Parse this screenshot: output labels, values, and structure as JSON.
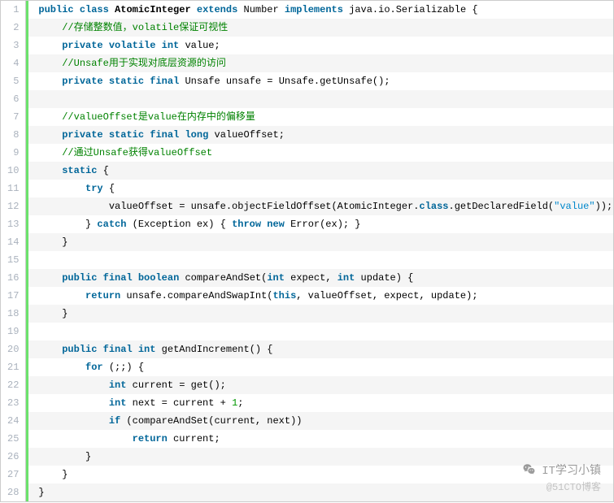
{
  "watermark": {
    "title": "IT学习小镇",
    "subtitle": "@51CTO博客"
  },
  "code": [
    {
      "n": 1,
      "alt": false,
      "indent": 0,
      "tokens": [
        {
          "t": "kw",
          "v": "public"
        },
        {
          "t": "plain",
          "v": " "
        },
        {
          "t": "kw",
          "v": "class"
        },
        {
          "t": "plain",
          "v": " "
        },
        {
          "t": "id",
          "v": "AtomicInteger"
        },
        {
          "t": "plain",
          "v": " "
        },
        {
          "t": "kw",
          "v": "extends"
        },
        {
          "t": "plain",
          "v": " Number "
        },
        {
          "t": "kw",
          "v": "implements"
        },
        {
          "t": "plain",
          "v": " java.io.Serializable {"
        }
      ]
    },
    {
      "n": 2,
      "alt": true,
      "indent": 1,
      "tokens": [
        {
          "t": "cmt",
          "v": "//存储整数值，volatile保证可视性"
        }
      ]
    },
    {
      "n": 3,
      "alt": false,
      "indent": 1,
      "tokens": [
        {
          "t": "kw",
          "v": "private"
        },
        {
          "t": "plain",
          "v": " "
        },
        {
          "t": "kw",
          "v": "volatile"
        },
        {
          "t": "plain",
          "v": " "
        },
        {
          "t": "kw",
          "v": "int"
        },
        {
          "t": "plain",
          "v": " value;"
        }
      ]
    },
    {
      "n": 4,
      "alt": true,
      "indent": 1,
      "tokens": [
        {
          "t": "cmt",
          "v": "//Unsafe用于实现对底层资源的访问"
        }
      ]
    },
    {
      "n": 5,
      "alt": false,
      "indent": 1,
      "tokens": [
        {
          "t": "kw",
          "v": "private"
        },
        {
          "t": "plain",
          "v": " "
        },
        {
          "t": "kw",
          "v": "static"
        },
        {
          "t": "plain",
          "v": " "
        },
        {
          "t": "kw",
          "v": "final"
        },
        {
          "t": "plain",
          "v": " Unsafe unsafe = Unsafe.getUnsafe();"
        }
      ]
    },
    {
      "n": 6,
      "alt": true,
      "indent": 0,
      "tokens": [
        {
          "t": "plain",
          "v": ""
        }
      ]
    },
    {
      "n": 7,
      "alt": false,
      "indent": 1,
      "tokens": [
        {
          "t": "cmt",
          "v": "//valueOffset是value在内存中的偏移量"
        }
      ]
    },
    {
      "n": 8,
      "alt": true,
      "indent": 1,
      "tokens": [
        {
          "t": "kw",
          "v": "private"
        },
        {
          "t": "plain",
          "v": " "
        },
        {
          "t": "kw",
          "v": "static"
        },
        {
          "t": "plain",
          "v": " "
        },
        {
          "t": "kw",
          "v": "final"
        },
        {
          "t": "plain",
          "v": " "
        },
        {
          "t": "kw",
          "v": "long"
        },
        {
          "t": "plain",
          "v": " valueOffset;"
        }
      ]
    },
    {
      "n": 9,
      "alt": false,
      "indent": 1,
      "tokens": [
        {
          "t": "cmt",
          "v": "//通过Unsafe获得valueOffset"
        }
      ]
    },
    {
      "n": 10,
      "alt": true,
      "indent": 1,
      "tokens": [
        {
          "t": "kw",
          "v": "static"
        },
        {
          "t": "plain",
          "v": " {"
        }
      ]
    },
    {
      "n": 11,
      "alt": false,
      "indent": 2,
      "tokens": [
        {
          "t": "kw",
          "v": "try"
        },
        {
          "t": "plain",
          "v": " {"
        }
      ]
    },
    {
      "n": 12,
      "alt": true,
      "indent": 3,
      "tokens": [
        {
          "t": "plain",
          "v": "valueOffset = unsafe.objectFieldOffset(AtomicInteger."
        },
        {
          "t": "kw",
          "v": "class"
        },
        {
          "t": "plain",
          "v": ".getDeclaredField("
        },
        {
          "t": "str",
          "v": "\"value\""
        },
        {
          "t": "plain",
          "v": "));"
        }
      ]
    },
    {
      "n": 13,
      "alt": false,
      "indent": 2,
      "tokens": [
        {
          "t": "plain",
          "v": "} "
        },
        {
          "t": "kw",
          "v": "catch"
        },
        {
          "t": "plain",
          "v": " (Exception ex) { "
        },
        {
          "t": "kw",
          "v": "throw"
        },
        {
          "t": "plain",
          "v": " "
        },
        {
          "t": "kw",
          "v": "new"
        },
        {
          "t": "plain",
          "v": " Error(ex); }"
        }
      ]
    },
    {
      "n": 14,
      "alt": true,
      "indent": 1,
      "tokens": [
        {
          "t": "plain",
          "v": "}"
        }
      ]
    },
    {
      "n": 15,
      "alt": false,
      "indent": 0,
      "tokens": [
        {
          "t": "plain",
          "v": ""
        }
      ]
    },
    {
      "n": 16,
      "alt": true,
      "indent": 1,
      "tokens": [
        {
          "t": "kw",
          "v": "public"
        },
        {
          "t": "plain",
          "v": " "
        },
        {
          "t": "kw",
          "v": "final"
        },
        {
          "t": "plain",
          "v": " "
        },
        {
          "t": "kw",
          "v": "boolean"
        },
        {
          "t": "plain",
          "v": " compareAndSet("
        },
        {
          "t": "kw",
          "v": "int"
        },
        {
          "t": "plain",
          "v": " expect, "
        },
        {
          "t": "kw",
          "v": "int"
        },
        {
          "t": "plain",
          "v": " update) {"
        }
      ]
    },
    {
      "n": 17,
      "alt": false,
      "indent": 2,
      "tokens": [
        {
          "t": "kw",
          "v": "return"
        },
        {
          "t": "plain",
          "v": " unsafe.compareAndSwapInt("
        },
        {
          "t": "kw",
          "v": "this"
        },
        {
          "t": "plain",
          "v": ", valueOffset, expect, update);"
        }
      ]
    },
    {
      "n": 18,
      "alt": true,
      "indent": 1,
      "tokens": [
        {
          "t": "plain",
          "v": "}"
        }
      ]
    },
    {
      "n": 19,
      "alt": false,
      "indent": 0,
      "tokens": [
        {
          "t": "plain",
          "v": ""
        }
      ]
    },
    {
      "n": 20,
      "alt": true,
      "indent": 1,
      "tokens": [
        {
          "t": "kw",
          "v": "public"
        },
        {
          "t": "plain",
          "v": " "
        },
        {
          "t": "kw",
          "v": "final"
        },
        {
          "t": "plain",
          "v": " "
        },
        {
          "t": "kw",
          "v": "int"
        },
        {
          "t": "plain",
          "v": " getAndIncrement() {"
        }
      ]
    },
    {
      "n": 21,
      "alt": false,
      "indent": 2,
      "tokens": [
        {
          "t": "kw",
          "v": "for"
        },
        {
          "t": "plain",
          "v": " (;;) {"
        }
      ]
    },
    {
      "n": 22,
      "alt": true,
      "indent": 3,
      "tokens": [
        {
          "t": "kw",
          "v": "int"
        },
        {
          "t": "plain",
          "v": " current = get();"
        }
      ]
    },
    {
      "n": 23,
      "alt": false,
      "indent": 3,
      "tokens": [
        {
          "t": "kw",
          "v": "int"
        },
        {
          "t": "plain",
          "v": " next = current + "
        },
        {
          "t": "num",
          "v": "1"
        },
        {
          "t": "plain",
          "v": ";"
        }
      ]
    },
    {
      "n": 24,
      "alt": true,
      "indent": 3,
      "tokens": [
        {
          "t": "kw",
          "v": "if"
        },
        {
          "t": "plain",
          "v": " (compareAndSet(current, next))"
        }
      ]
    },
    {
      "n": 25,
      "alt": false,
      "indent": 4,
      "tokens": [
        {
          "t": "kw",
          "v": "return"
        },
        {
          "t": "plain",
          "v": " current;"
        }
      ]
    },
    {
      "n": 26,
      "alt": true,
      "indent": 2,
      "tokens": [
        {
          "t": "plain",
          "v": "}"
        }
      ]
    },
    {
      "n": 27,
      "alt": false,
      "indent": 1,
      "tokens": [
        {
          "t": "plain",
          "v": "}"
        }
      ]
    },
    {
      "n": 28,
      "alt": true,
      "indent": 0,
      "tokens": [
        {
          "t": "plain",
          "v": "}"
        }
      ]
    }
  ]
}
